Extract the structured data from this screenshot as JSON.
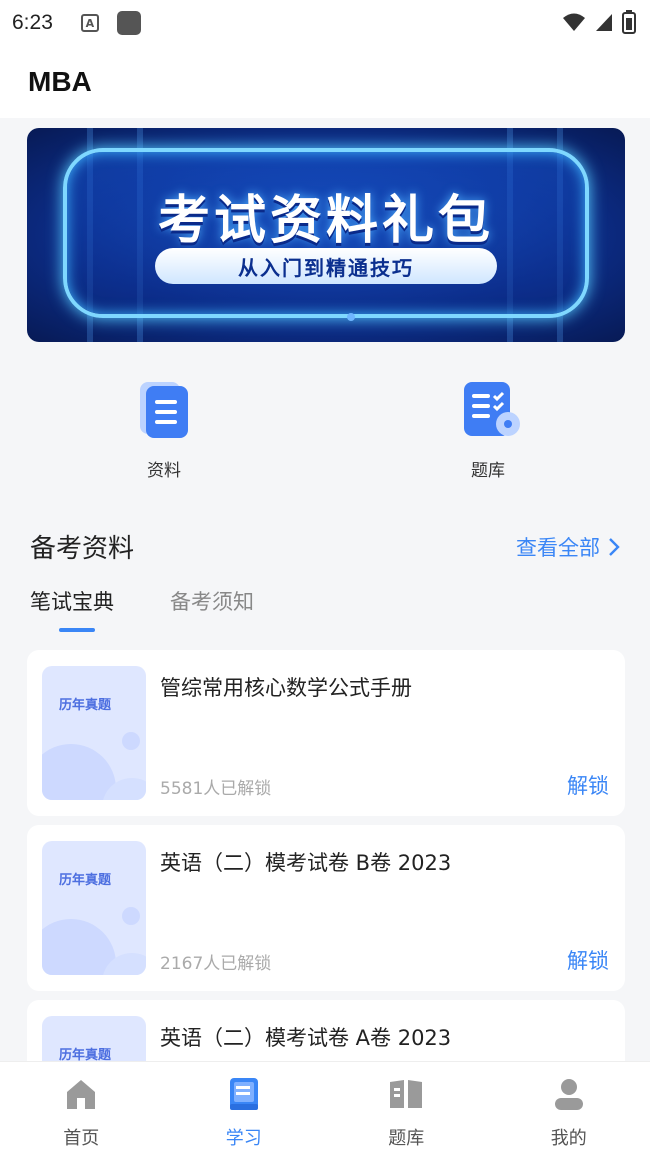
{
  "status": {
    "time": "6:23",
    "a_icon": "A"
  },
  "header": {
    "title": "MBA"
  },
  "banner": {
    "title": "考试资料礼包",
    "subtitle": "从入门到精通技巧"
  },
  "quick": [
    {
      "label": "资料",
      "icon": "document-icon"
    },
    {
      "label": "题库",
      "icon": "question-bank-icon"
    }
  ],
  "section": {
    "title": "备考资料",
    "view_all": "查看全部"
  },
  "tabs": [
    {
      "label": "笔试宝典",
      "active": true
    },
    {
      "label": "备考须知",
      "active": false
    }
  ],
  "cards": [
    {
      "badge": "历年真题",
      "title": "管综常用核心数学公式手册",
      "count": "5581人已解锁",
      "action": "解锁"
    },
    {
      "badge": "历年真题",
      "title": "英语（二）模考试卷 B卷 2023",
      "count": "2167人已解锁",
      "action": "解锁"
    },
    {
      "badge": "历年真题",
      "title": "英语（二）模考试卷 A卷 2023",
      "count": "",
      "action": ""
    }
  ],
  "tabbar": [
    {
      "label": "首页",
      "icon": "home-icon"
    },
    {
      "label": "学习",
      "icon": "study-icon",
      "active": true
    },
    {
      "label": "题库",
      "icon": "book-icon"
    },
    {
      "label": "我的",
      "icon": "profile-icon"
    }
  ],
  "colors": {
    "accent": "#3a86f6",
    "background": "#f5f6f8",
    "thumb": "#dfe7ff"
  }
}
